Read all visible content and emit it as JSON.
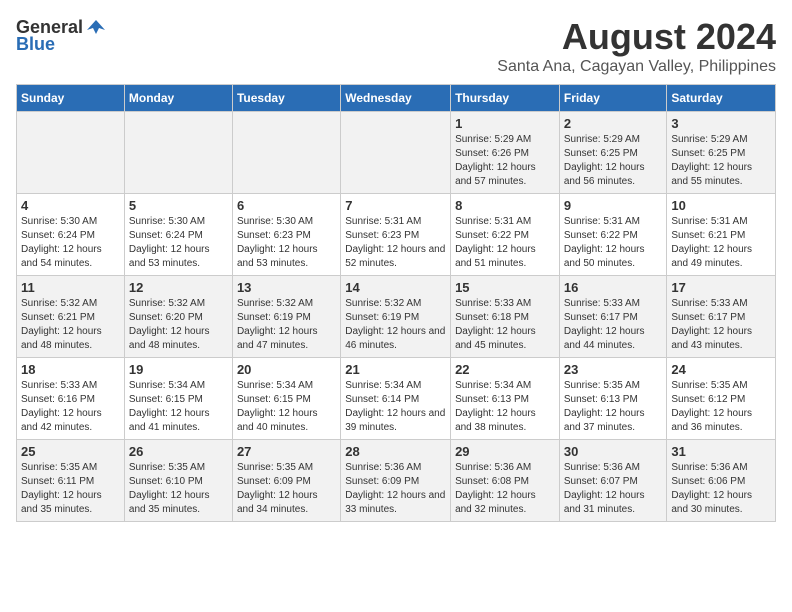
{
  "logo": {
    "general": "General",
    "blue": "Blue"
  },
  "title": "August 2024",
  "subtitle": "Santa Ana, Cagayan Valley, Philippines",
  "days_of_week": [
    "Sunday",
    "Monday",
    "Tuesday",
    "Wednesday",
    "Thursday",
    "Friday",
    "Saturday"
  ],
  "weeks": [
    {
      "days": [
        {
          "num": "",
          "content": ""
        },
        {
          "num": "",
          "content": ""
        },
        {
          "num": "",
          "content": ""
        },
        {
          "num": "",
          "content": ""
        },
        {
          "num": "1",
          "content": "Sunrise: 5:29 AM\nSunset: 6:26 PM\nDaylight: 12 hours and 57 minutes."
        },
        {
          "num": "2",
          "content": "Sunrise: 5:29 AM\nSunset: 6:25 PM\nDaylight: 12 hours and 56 minutes."
        },
        {
          "num": "3",
          "content": "Sunrise: 5:29 AM\nSunset: 6:25 PM\nDaylight: 12 hours and 55 minutes."
        }
      ]
    },
    {
      "days": [
        {
          "num": "4",
          "content": "Sunrise: 5:30 AM\nSunset: 6:24 PM\nDaylight: 12 hours and 54 minutes."
        },
        {
          "num": "5",
          "content": "Sunrise: 5:30 AM\nSunset: 6:24 PM\nDaylight: 12 hours and 53 minutes."
        },
        {
          "num": "6",
          "content": "Sunrise: 5:30 AM\nSunset: 6:23 PM\nDaylight: 12 hours and 53 minutes."
        },
        {
          "num": "7",
          "content": "Sunrise: 5:31 AM\nSunset: 6:23 PM\nDaylight: 12 hours and 52 minutes."
        },
        {
          "num": "8",
          "content": "Sunrise: 5:31 AM\nSunset: 6:22 PM\nDaylight: 12 hours and 51 minutes."
        },
        {
          "num": "9",
          "content": "Sunrise: 5:31 AM\nSunset: 6:22 PM\nDaylight: 12 hours and 50 minutes."
        },
        {
          "num": "10",
          "content": "Sunrise: 5:31 AM\nSunset: 6:21 PM\nDaylight: 12 hours and 49 minutes."
        }
      ]
    },
    {
      "days": [
        {
          "num": "11",
          "content": "Sunrise: 5:32 AM\nSunset: 6:21 PM\nDaylight: 12 hours and 48 minutes."
        },
        {
          "num": "12",
          "content": "Sunrise: 5:32 AM\nSunset: 6:20 PM\nDaylight: 12 hours and 48 minutes."
        },
        {
          "num": "13",
          "content": "Sunrise: 5:32 AM\nSunset: 6:19 PM\nDaylight: 12 hours and 47 minutes."
        },
        {
          "num": "14",
          "content": "Sunrise: 5:32 AM\nSunset: 6:19 PM\nDaylight: 12 hours and 46 minutes."
        },
        {
          "num": "15",
          "content": "Sunrise: 5:33 AM\nSunset: 6:18 PM\nDaylight: 12 hours and 45 minutes."
        },
        {
          "num": "16",
          "content": "Sunrise: 5:33 AM\nSunset: 6:17 PM\nDaylight: 12 hours and 44 minutes."
        },
        {
          "num": "17",
          "content": "Sunrise: 5:33 AM\nSunset: 6:17 PM\nDaylight: 12 hours and 43 minutes."
        }
      ]
    },
    {
      "days": [
        {
          "num": "18",
          "content": "Sunrise: 5:33 AM\nSunset: 6:16 PM\nDaylight: 12 hours and 42 minutes."
        },
        {
          "num": "19",
          "content": "Sunrise: 5:34 AM\nSunset: 6:15 PM\nDaylight: 12 hours and 41 minutes."
        },
        {
          "num": "20",
          "content": "Sunrise: 5:34 AM\nSunset: 6:15 PM\nDaylight: 12 hours and 40 minutes."
        },
        {
          "num": "21",
          "content": "Sunrise: 5:34 AM\nSunset: 6:14 PM\nDaylight: 12 hours and 39 minutes."
        },
        {
          "num": "22",
          "content": "Sunrise: 5:34 AM\nSunset: 6:13 PM\nDaylight: 12 hours and 38 minutes."
        },
        {
          "num": "23",
          "content": "Sunrise: 5:35 AM\nSunset: 6:13 PM\nDaylight: 12 hours and 37 minutes."
        },
        {
          "num": "24",
          "content": "Sunrise: 5:35 AM\nSunset: 6:12 PM\nDaylight: 12 hours and 36 minutes."
        }
      ]
    },
    {
      "days": [
        {
          "num": "25",
          "content": "Sunrise: 5:35 AM\nSunset: 6:11 PM\nDaylight: 12 hours and 35 minutes."
        },
        {
          "num": "26",
          "content": "Sunrise: 5:35 AM\nSunset: 6:10 PM\nDaylight: 12 hours and 35 minutes."
        },
        {
          "num": "27",
          "content": "Sunrise: 5:35 AM\nSunset: 6:09 PM\nDaylight: 12 hours and 34 minutes."
        },
        {
          "num": "28",
          "content": "Sunrise: 5:36 AM\nSunset: 6:09 PM\nDaylight: 12 hours and 33 minutes."
        },
        {
          "num": "29",
          "content": "Sunrise: 5:36 AM\nSunset: 6:08 PM\nDaylight: 12 hours and 32 minutes."
        },
        {
          "num": "30",
          "content": "Sunrise: 5:36 AM\nSunset: 6:07 PM\nDaylight: 12 hours and 31 minutes."
        },
        {
          "num": "31",
          "content": "Sunrise: 5:36 AM\nSunset: 6:06 PM\nDaylight: 12 hours and 30 minutes."
        }
      ]
    }
  ]
}
